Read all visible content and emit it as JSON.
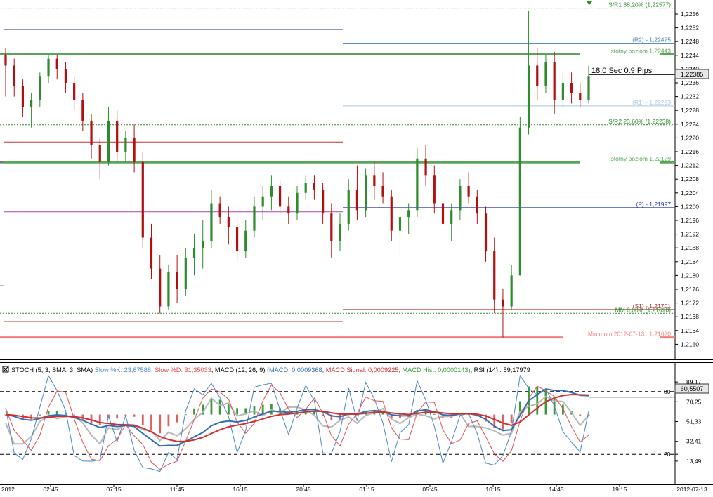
{
  "chart_data": [
    {
      "type": "candlestick",
      "ylim": [
        1.2159,
        1.2261
      ],
      "price_ticks": [
        "1,2256",
        "1,2252",
        "1,2248",
        "1,2244",
        "1,2240",
        "1,2236",
        "1,2232",
        "1,2228",
        "1,2224",
        "1,2220",
        "1,2216",
        "1,2212",
        "1,2208",
        "1,2204",
        "1,2200",
        "1,2196",
        "1,2192",
        "1,2188",
        "1,2184",
        "1,2180",
        "1,2176",
        "1,2172",
        "1,2168",
        "1,2164",
        "1,2160"
      ],
      "current_price": "1,22385",
      "tick_info": "18.0 Sec 0.9 Pips",
      "levels": [
        {
          "label": "S/R1 38,20% (1,22577)",
          "price": 1.22577,
          "color": "#2e8b2e",
          "style": "dotted"
        },
        {
          "label": "(R2) - 1,22475",
          "price": 1.22475,
          "color": "#4a7fb5",
          "style": "solid"
        },
        {
          "label": "Istotny poziom   1,22443",
          "price": 1.22443,
          "color": "#5aa55a",
          "style": "thick"
        },
        {
          "label": "(R1) - 1,22293",
          "price": 1.22293,
          "color": "#a8c8e0",
          "style": "solid"
        },
        {
          "label": "S/R2 23,60% (1,22238)",
          "price": 1.22238,
          "color": "#2e8b2e",
          "style": "dotted"
        },
        {
          "label": "Istotny poziom   1,22129",
          "price": 1.22129,
          "color": "#5aa55a",
          "style": "thick"
        },
        {
          "label": "(P)  - 1,21997",
          "price": 1.21997,
          "color": "#1f2fa8",
          "style": "solid"
        },
        {
          "label": "(S1) - 1,21701",
          "price": 1.21701,
          "color": "#b03030",
          "style": "solid"
        },
        {
          "label": "MM 0,00% (1,21690)",
          "price": 1.2169,
          "color": "#2e8b2e",
          "style": "dotted"
        },
        {
          "label": "Minimum 2012-07-13 : 1,21620",
          "price": 1.2162,
          "color": "#f08080",
          "style": "thick"
        }
      ],
      "prev_day_levels": [
        {
          "price": 1.22515,
          "color": "#1f2f8a"
        },
        {
          "price": 1.22188,
          "color": "#c03030"
        },
        {
          "price": 1.21985,
          "color": "#b040b0"
        },
        {
          "price": 1.21666,
          "color": "#c03030"
        }
      ],
      "series_days": [
        {
          "day": 1,
          "points": [
            [
              1.2244,
              1.2246,
              1.2232,
              1.2241
            ],
            [
              1.2241,
              1.2243,
              1.2232,
              1.2235
            ],
            [
              1.2235,
              1.2237,
              1.2226,
              1.2229
            ],
            [
              1.2229,
              1.2233,
              1.2223,
              1.2231
            ],
            [
              1.2231,
              1.2239,
              1.2229,
              1.2238
            ],
            [
              1.2238,
              1.2244,
              1.2236,
              1.2243
            ],
            [
              1.2243,
              1.2244,
              1.2237,
              1.224
            ],
            [
              1.224,
              1.2242,
              1.2233,
              1.2236
            ],
            [
              1.2236,
              1.2238,
              1.2228,
              1.2231
            ],
            [
              1.2231,
              1.2233,
              1.2222,
              1.2225
            ],
            [
              1.2225,
              1.2227,
              1.2214,
              1.2218
            ],
            [
              1.2218,
              1.222,
              1.2208,
              1.2213
            ],
            [
              1.2213,
              1.2229,
              1.2212,
              1.2225
            ],
            [
              1.2225,
              1.2228,
              1.2213,
              1.2216
            ],
            [
              1.2216,
              1.2222,
              1.2213,
              1.222
            ],
            [
              1.222,
              1.2224,
              1.221,
              1.2213
            ],
            [
              1.2213,
              1.2216,
              1.2188,
              1.2191
            ],
            [
              1.2191,
              1.2195,
              1.2179,
              1.2182
            ],
            [
              1.2182,
              1.2186,
              1.2169,
              1.2171
            ],
            [
              1.2171,
              1.2183,
              1.217,
              1.2181
            ],
            [
              1.2181,
              1.2186,
              1.2172,
              1.2176
            ],
            [
              1.2176,
              1.2188,
              1.2174,
              1.2185
            ],
            [
              1.2185,
              1.2192,
              1.218,
              1.2188
            ],
            [
              1.2188,
              1.2196,
              1.2182,
              1.219
            ],
            [
              1.219,
              1.2205,
              1.2188,
              1.2201
            ],
            [
              1.2201,
              1.2203,
              1.2195,
              1.2197
            ],
            [
              1.2197,
              1.22,
              1.2189,
              1.2194
            ],
            [
              1.2194,
              1.2197,
              1.2184,
              1.2187
            ],
            [
              1.2187,
              1.2196,
              1.2185,
              1.2193
            ],
            [
              1.2193,
              1.2203,
              1.2191,
              1.22
            ],
            [
              1.22,
              1.2206,
              1.2196,
              1.2203
            ],
            [
              1.2203,
              1.2209,
              1.2199,
              1.2206
            ],
            [
              1.2206,
              1.2208,
              1.2198,
              1.22
            ],
            [
              1.22,
              1.2203,
              1.2195,
              1.2198
            ],
            [
              1.2198,
              1.2206,
              1.2196,
              1.2204
            ],
            [
              1.2204,
              1.2209,
              1.2202,
              1.2207
            ],
            [
              1.2207,
              1.2209,
              1.2202,
              1.2205
            ],
            [
              1.2205,
              1.2207,
              1.2195,
              1.2198
            ]
          ]
        },
        {
          "day": 2,
          "points": [
            [
              1.2198,
              1.2201,
              1.2185,
              1.219
            ],
            [
              1.219,
              1.2198,
              1.2187,
              1.2195
            ],
            [
              1.2195,
              1.2208,
              1.2193,
              1.2205
            ],
            [
              1.2205,
              1.2212,
              1.2196,
              1.2199
            ],
            [
              1.2199,
              1.2211,
              1.2197,
              1.2209
            ],
            [
              1.2209,
              1.2213,
              1.2202,
              1.2206
            ],
            [
              1.2206,
              1.221,
              1.2201,
              1.2203
            ],
            [
              1.2203,
              1.2205,
              1.219,
              1.2193
            ],
            [
              1.2193,
              1.2199,
              1.2186,
              1.2197
            ],
            [
              1.2197,
              1.2201,
              1.2192,
              1.2199
            ],
            [
              1.2199,
              1.2217,
              1.2197,
              1.2214
            ],
            [
              1.2214,
              1.2218,
              1.2206,
              1.2209
            ],
            [
              1.2209,
              1.2212,
              1.2198,
              1.2201
            ],
            [
              1.2201,
              1.2205,
              1.2192,
              1.2195
            ],
            [
              1.2195,
              1.2201,
              1.219,
              1.2199
            ],
            [
              1.2199,
              1.2208,
              1.2196,
              1.2206
            ],
            [
              1.2206,
              1.221,
              1.2201,
              1.2203
            ],
            [
              1.2203,
              1.2205,
              1.2195,
              1.2198
            ],
            [
              1.2198,
              1.22,
              1.2184,
              1.2187
            ],
            [
              1.2187,
              1.2191,
              1.2169,
              1.2173
            ],
            [
              1.2173,
              1.2176,
              1.2162,
              1.2171
            ],
            [
              1.2171,
              1.2183,
              1.217,
              1.218
            ],
            [
              1.218,
              1.2226,
              1.218,
              1.2223
            ],
            [
              1.2223,
              1.2257,
              1.2221,
              1.2241
            ],
            [
              1.2241,
              1.2246,
              1.2231,
              1.2235
            ],
            [
              1.2235,
              1.2244,
              1.2233,
              1.2242
            ],
            [
              1.2242,
              1.2245,
              1.2227,
              1.2231
            ],
            [
              1.2231,
              1.2239,
              1.2229,
              1.2236
            ],
            [
              1.2236,
              1.2239,
              1.223,
              1.2233
            ],
            [
              1.2233,
              1.2236,
              1.2229,
              1.2231
            ],
            [
              1.2231,
              1.2241,
              1.223,
              1.2238
            ]
          ]
        }
      ],
      "x_ticks": [
        "2012",
        "02:45",
        "07:15",
        "11:45",
        "16:15",
        "20:45",
        "01:15",
        "05:45",
        "10:15",
        "14:45",
        "19:15",
        "2012-07-13"
      ]
    },
    {
      "type": "line",
      "legend": {
        "stoch": "STOCH (5, 3, SMA, 3, SMA)",
        "slowk": "Slow %K: 23,67588",
        "slowd": "Slow %D: 31,35033",
        "macd_head": ", MACD (12, 26, 9)",
        "macd": "(MACD: 0,0009368,",
        "signal": "MACD Signal: 0,0009225,",
        "hist": "MACD Hist: 0,0000143)",
        "rsi": ", RSI (14) : 59,17979"
      },
      "ylim": [
        0,
        100
      ],
      "y_ticks": [
        "89,17",
        "80",
        "70,25",
        "51,33",
        "32,41",
        "20",
        "13,49"
      ],
      "current_value": "60,5507",
      "ref_levels": [
        80,
        20
      ],
      "colors": {
        "slowk": "#4a86c8",
        "slowd": "#e05050",
        "macd": "#3070b0",
        "signal": "#d03030",
        "hist_pos": "#3a9a3a",
        "hist_neg": "#e06060",
        "rsi": "#b8b8b8"
      }
    }
  ]
}
